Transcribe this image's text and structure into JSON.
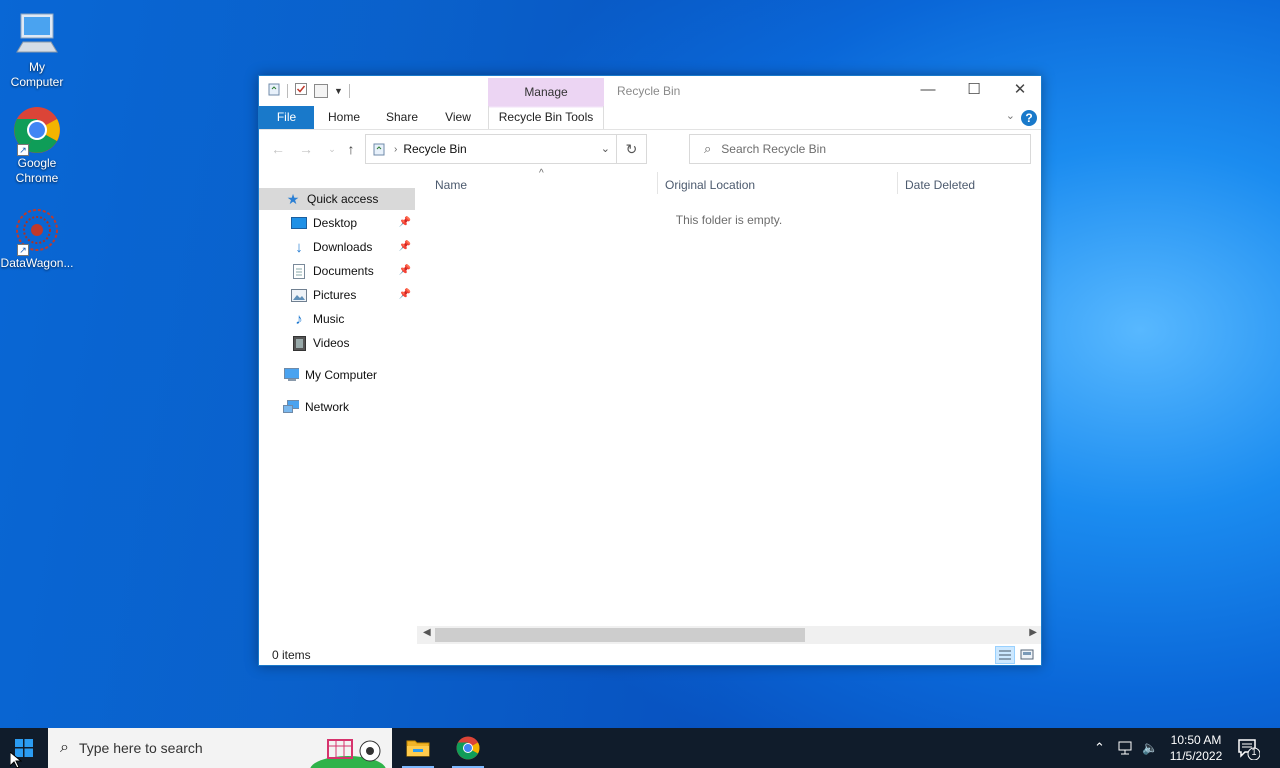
{
  "desktop": {
    "icons": [
      {
        "label": "My\nComputer",
        "icon": "computer-icon"
      },
      {
        "label": "Google\nChrome",
        "icon": "chrome-icon"
      },
      {
        "label": "DataWagon...",
        "icon": "datawagon-icon"
      }
    ]
  },
  "window": {
    "title": "Recycle Bin",
    "context_tab": "Manage",
    "ribbon_tabs": [
      "File",
      "Home",
      "Share",
      "View",
      "Recycle Bin Tools"
    ],
    "address": {
      "crumb": "Recycle Bin"
    },
    "search": {
      "placeholder": "Search Recycle Bin"
    },
    "nav": {
      "quick_access": "Quick access",
      "items": [
        "Desktop",
        "Downloads",
        "Documents",
        "Pictures",
        "Music",
        "Videos"
      ],
      "my_computer": "My Computer",
      "network": "Network"
    },
    "columns": [
      "Name",
      "Original Location",
      "Date Deleted"
    ],
    "empty_message": "This folder is empty.",
    "status": "0 items"
  },
  "taskbar": {
    "search_placeholder": "Type here to search",
    "time": "10:50 AM",
    "date": "11/5/2022",
    "notification_count": "1"
  },
  "colors": {
    "accent": "#1979ca",
    "manage_tab": "#ecd5f3",
    "taskbar": "#101c2b"
  }
}
